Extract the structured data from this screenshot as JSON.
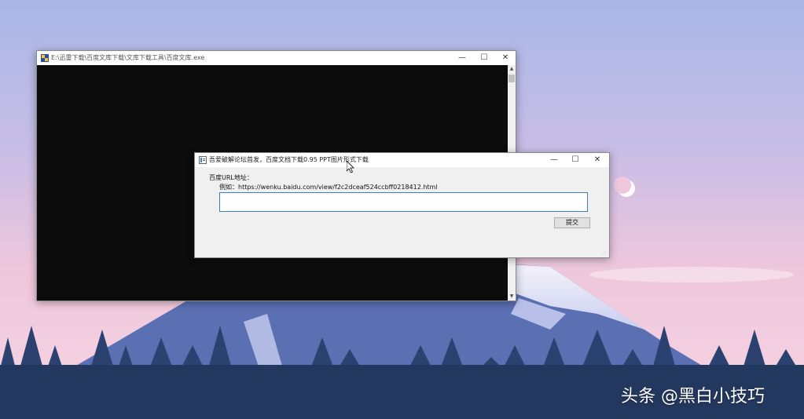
{
  "console_window": {
    "title": "E:\\迅雷下载\\百度文库下载\\文库下载工具\\百度文库.exe",
    "minimize": "—",
    "maximize": "☐",
    "close": "✕"
  },
  "dialog": {
    "title": "吾爱破解论坛首发，百度文档下载0.95 PPT图片形式下载",
    "minimize": "—",
    "maximize": "☐",
    "close": "✕",
    "url_label": "百度URL地址：",
    "example_label": "例如：https://wenku.baidu.com/view/f2c2dceaf524ccbff0218412.html",
    "url_input_value": "",
    "submit_label": "提交"
  },
  "watermark": {
    "text": "头条 @黑白小技巧"
  },
  "colors": {
    "sky_top": "#aab8e6",
    "sky_mid": "#e9c5dd",
    "mountain": "#5b6fb3",
    "trees": "#243a63",
    "input_border": "#3c7fb1"
  }
}
